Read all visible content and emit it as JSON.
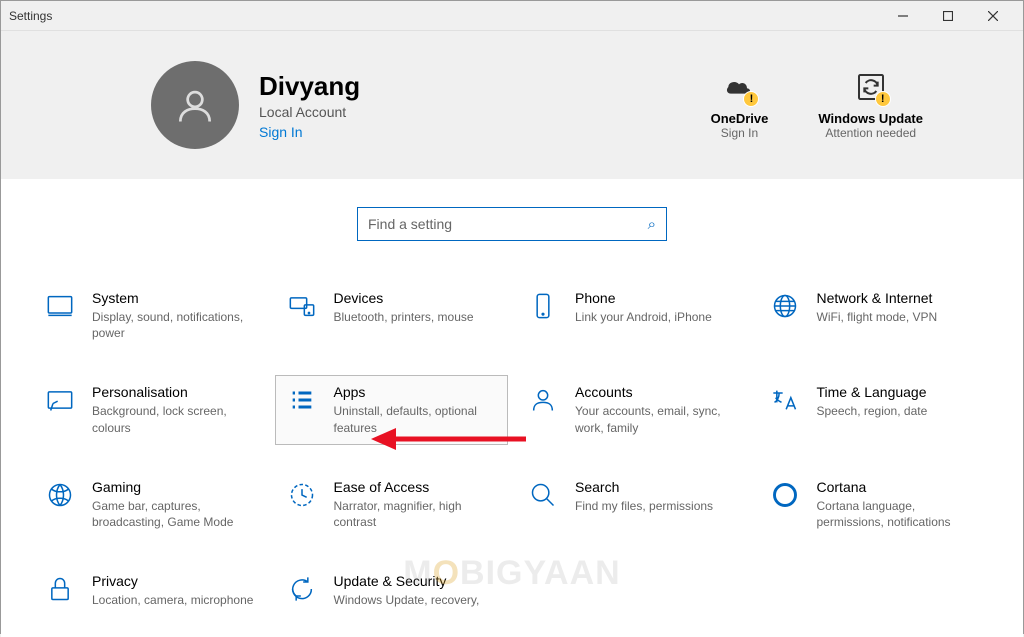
{
  "window": {
    "title": "Settings"
  },
  "user": {
    "name": "Divyang",
    "type": "Local Account",
    "signin": "Sign In"
  },
  "status": {
    "onedrive": {
      "title": "OneDrive",
      "sub": "Sign In"
    },
    "update": {
      "title": "Windows Update",
      "sub": "Attention needed"
    }
  },
  "search": {
    "placeholder": "Find a setting"
  },
  "tiles": {
    "system": {
      "title": "System",
      "desc": "Display, sound, notifications, power"
    },
    "devices": {
      "title": "Devices",
      "desc": "Bluetooth, printers, mouse"
    },
    "phone": {
      "title": "Phone",
      "desc": "Link your Android, iPhone"
    },
    "network": {
      "title": "Network & Internet",
      "desc": "WiFi, flight mode, VPN"
    },
    "personalisation": {
      "title": "Personalisation",
      "desc": "Background, lock screen, colours"
    },
    "apps": {
      "title": "Apps",
      "desc": "Uninstall, defaults, optional features"
    },
    "accounts": {
      "title": "Accounts",
      "desc": "Your accounts, email, sync, work, family"
    },
    "time": {
      "title": "Time & Language",
      "desc": "Speech, region, date"
    },
    "gaming": {
      "title": "Gaming",
      "desc": "Game bar, captures, broadcasting, Game Mode"
    },
    "ease": {
      "title": "Ease of Access",
      "desc": "Narrator, magnifier, high contrast"
    },
    "search_tile": {
      "title": "Search",
      "desc": "Find my files, permissions"
    },
    "cortana": {
      "title": "Cortana",
      "desc": "Cortana language, permissions, notifications"
    },
    "privacy": {
      "title": "Privacy",
      "desc": "Location, camera, microphone"
    },
    "update_tile": {
      "title": "Update & Security",
      "desc": "Windows Update, recovery,"
    }
  },
  "watermark": "MOBIGYAAN"
}
